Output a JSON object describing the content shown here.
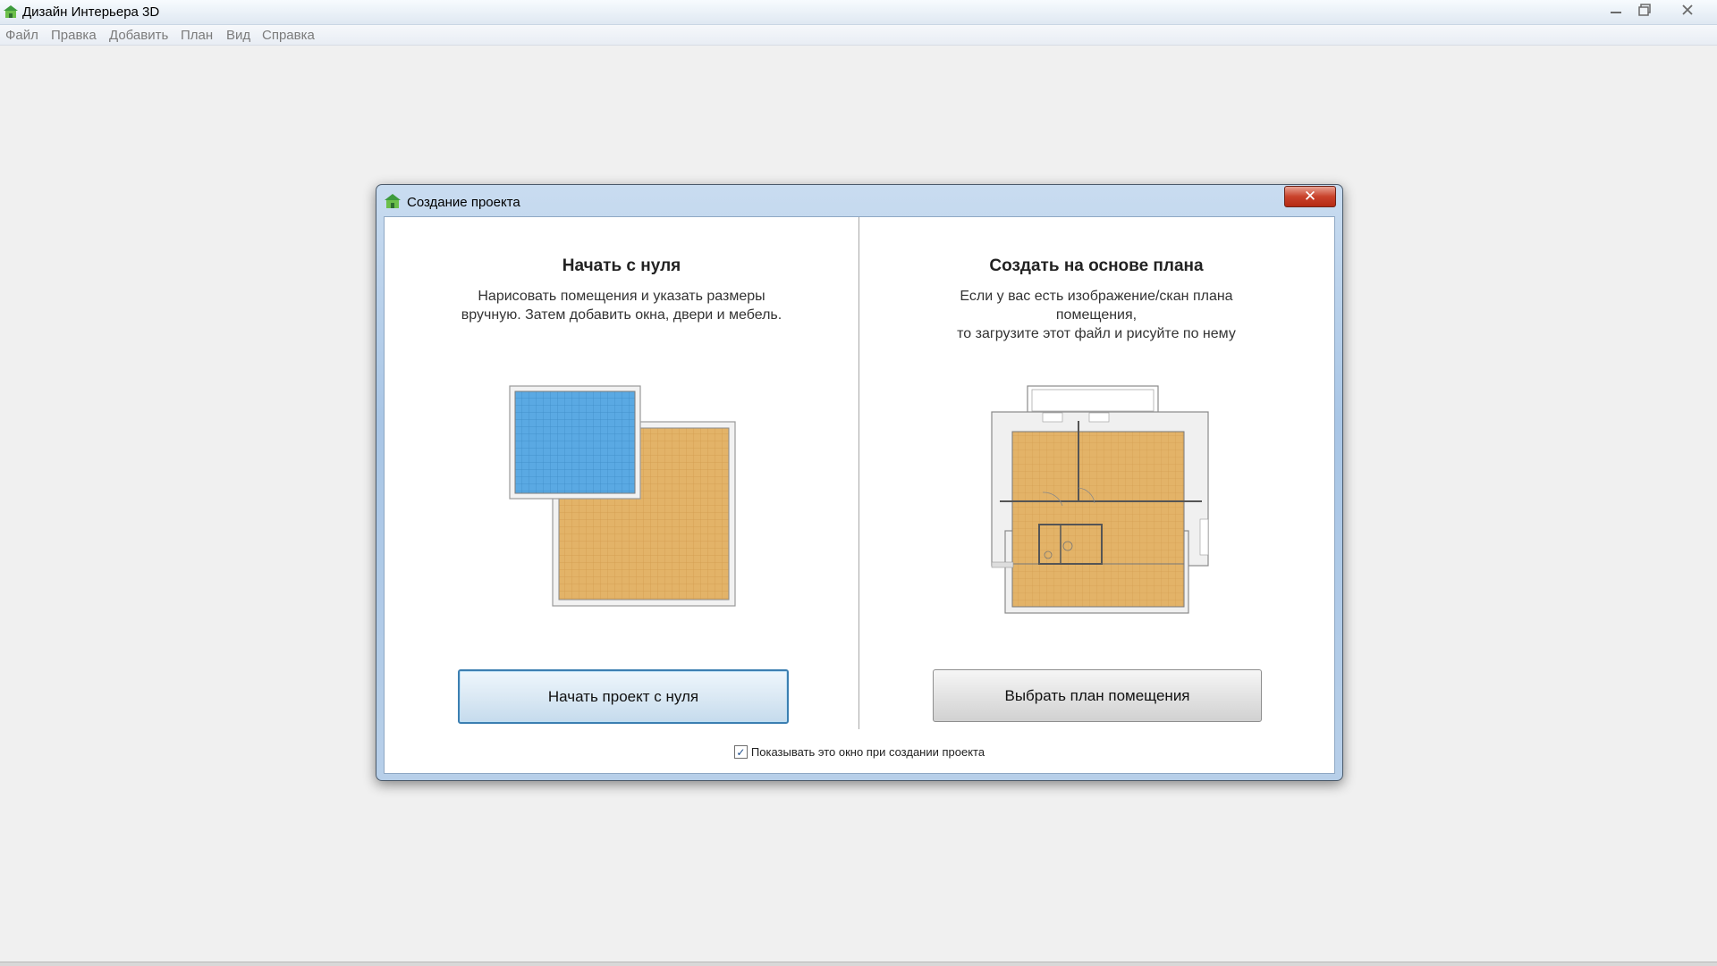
{
  "app": {
    "title": "Дизайн Интерьера 3D",
    "window_controls": [
      "minimize-icon",
      "restore-icon",
      "close-icon"
    ]
  },
  "menu": {
    "items": [
      "Файл",
      "Правка",
      "Добавить",
      "План",
      "Вид",
      "Справка"
    ]
  },
  "dialog": {
    "title": "Создание проекта",
    "close_glyph": "✕",
    "left": {
      "heading": "Начать с нуля",
      "description": "Нарисовать помещения и указать размеры\nвручную. Затем добавить окна, двери и мебель.",
      "button_label": "Начать проект с нуля"
    },
    "right": {
      "heading": "Создать на основе плана",
      "description": "Если у вас есть изображение/скан плана\nпомещения,\nто загрузите этот файл и рисуйте по нему",
      "button_label": "Выбрать план помещения"
    },
    "checkbox": {
      "label": "Показывать это окно при создании проекта",
      "checked": true,
      "check_glyph": "✓"
    }
  },
  "colors": {
    "floor_orange": "#e3b368",
    "floor_blue": "#5aa9e3",
    "focus_blue": "#3c7fb1",
    "close_red": "#c9422b"
  }
}
